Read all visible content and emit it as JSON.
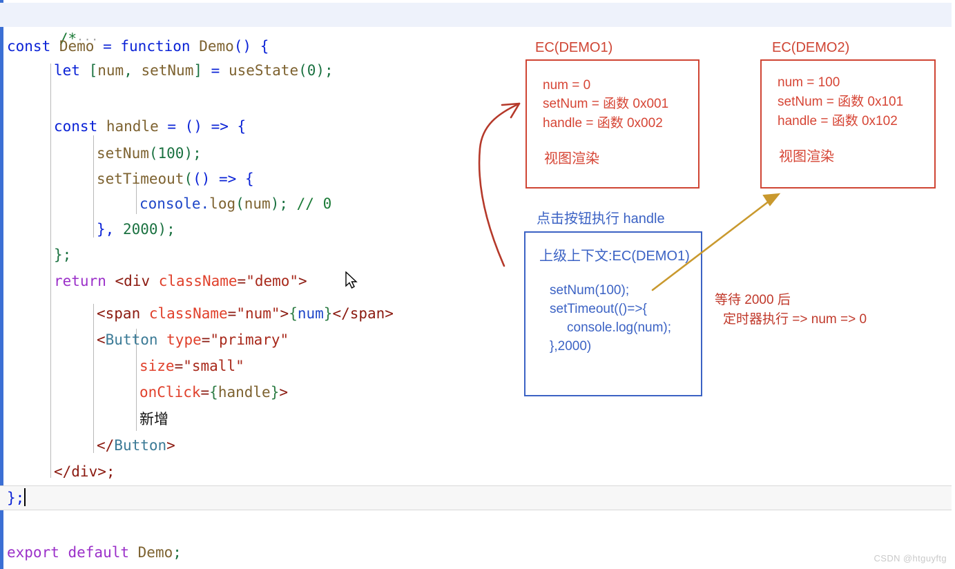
{
  "editor": {
    "folded_comment": "/*",
    "fold_marker": "···",
    "lines": {
      "l2_const": "const",
      "l2_demo": "Demo",
      "l2_eq": " = ",
      "l2_function": "function",
      "l2_name": "Demo",
      "l2_tail": "() {",
      "l3_let": "let",
      "l3_open": "[",
      "l3_num": "num",
      "l3_comma": ", ",
      "l3_setnum": "setNum",
      "l3_close": "]",
      "l3_eq": " = ",
      "l3_usestate": "useState",
      "l3_paren_open": "(",
      "l3_zero": "0",
      "l3_paren_close": ");",
      "l5_const": "const",
      "l5_handle": "handle",
      "l5_eq": " = ",
      "l5_arrow": "() => {",
      "l6_setnum": "setNum",
      "l6_args": "(",
      "l6_100": "100",
      "l6_end": ");",
      "l7_settimeout": "setTimeout",
      "l7_open": "(",
      "l7_fn": "() => {",
      "l8_console": "console",
      "l8_dot": ".",
      "l8_log": "log",
      "l8_paren_open": "(",
      "l8_num": "num",
      "l8_paren_close": ");",
      "l8_comment": "// 0",
      "l9_close": "}, ",
      "l9_2000": "2000",
      "l9_end": ");",
      "l10_close": "};",
      "l11_return": "return",
      "l11_tag_open": "<div ",
      "l11_attr": "className",
      "l11_eq": "=",
      "l11_str": "\"demo\"",
      "l11_gt": ">",
      "l12_tag_open": "<span ",
      "l12_attr": "className",
      "l12_eq": "=",
      "l12_str": "\"num\"",
      "l12_gt": ">",
      "l12_brace_open": "{",
      "l12_expr": "num",
      "l12_brace_close": "}",
      "l12_close_tag": "</span>",
      "l13_lt": "<",
      "l13_comp": "Button",
      "l13_attr": " type",
      "l13_eq": "=",
      "l13_str": "\"primary\"",
      "l14_attr": "size",
      "l14_eq": "=",
      "l14_str": "\"small\"",
      "l15_attr": "onClick",
      "l15_eq": "=",
      "l15_brace_open": "{",
      "l15_expr": "handle",
      "l15_brace_close": "}",
      "l15_gt": ">",
      "l16_text": "新增",
      "l17_close": "</",
      "l17_comp": "Button",
      "l17_gt": ">",
      "l18_close": "</div>;",
      "l19_close": "};",
      "l21_export": "export default ",
      "l21_demo": "Demo",
      "l21_semi": ";"
    }
  },
  "annotations": {
    "ec1": {
      "title": "EC(DEMO1)",
      "lines": [
        "num = 0",
        "setNum = 函数 0x001",
        "handle = 函数 0x002"
      ],
      "render_label": "视图渲染",
      "color": "#cf4433"
    },
    "ec2": {
      "title": "EC(DEMO2)",
      "lines": [
        "num = 100",
        "setNum = 函数 0x101",
        "handle = 函数 0x102"
      ],
      "render_label": "视图渲染",
      "color": "#cf4433"
    },
    "click_label": "点击按钮执行 handle",
    "handle_box": {
      "header": "上级上下文:EC(DEMO1)",
      "lines": [
        "setNum(100);",
        "setTimeout(()=>{",
        "console.log(num);",
        "},2000)"
      ],
      "color": "#3b62c4"
    },
    "timer_note": {
      "line1": "等待 2000 后",
      "line2": "定时器执行 => num => 0",
      "color": "#c0392b"
    },
    "arrow_red_color": "#b5392a",
    "arrow_gold_color": "#c9992e"
  },
  "watermark": "CSDN @htguyftg"
}
